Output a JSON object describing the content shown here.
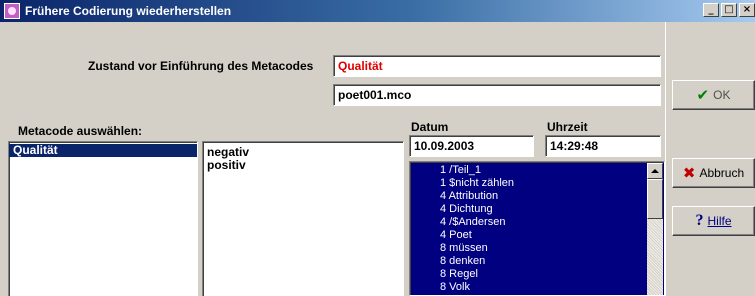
{
  "window": {
    "title": "Frühere Codierung wiederherstellen",
    "controls": {
      "minimize": "_",
      "maximize": "□",
      "close": "×"
    }
  },
  "form": {
    "state_label": "Zustand vor Einführung des Metacodes",
    "metacode_value": "Qualität",
    "file_value": "poet001.mco",
    "select_label": "Metacode auswählen:",
    "date_label": "Datum",
    "date_value": "10.09.2003",
    "time_label": "Uhrzeit",
    "time_value": "14:29:48"
  },
  "metacode_list": [
    {
      "label": "Qualität",
      "selected": true
    }
  ],
  "values_list": [
    "negativ",
    "positiv"
  ],
  "code_list": [
    "1 /Teil_1",
    "1 $nicht zählen",
    "4 Attribution",
    "4 Dichtung",
    "4 /$Andersen",
    "4 Poet",
    "8 müssen",
    "8 denken",
    "8 Regel",
    "8 Volk"
  ],
  "buttons": {
    "ok": "OK",
    "cancel": "Abbruch",
    "help": "Hilfe"
  },
  "colors": {
    "title_bar": "#0a246a",
    "selection": "#0a246a",
    "code_list_bg": "#000080",
    "metacode_text": "#e00000",
    "ok_icon": "#008000",
    "cancel_icon": "#c00000"
  },
  "icons": {
    "app": "app-icon",
    "ok": "check-icon",
    "cancel": "x-icon",
    "help": "question-icon"
  }
}
